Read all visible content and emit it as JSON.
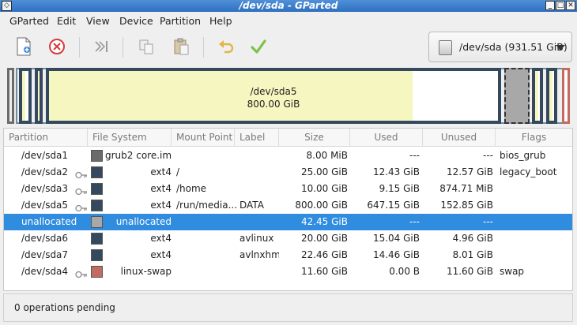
{
  "window": {
    "title": "/dev/sda - GParted"
  },
  "menu": [
    "GParted",
    "Edit",
    "View",
    "Device",
    "Partition",
    "Help"
  ],
  "toolbar": {
    "buttons": [
      "new-icon",
      "delete-icon",
      "resize-move-icon",
      "copy-icon",
      "paste-icon",
      "undo-icon",
      "apply-icon"
    ],
    "device": "/dev/sda  (931.51 GiB)"
  },
  "diskmap": {
    "selected_label": "/dev/sda5",
    "selected_size": "800.00 GiB",
    "colors": {
      "ext4": "#34495e",
      "swap": "#c26b5f",
      "unallocated": "#a8a8a8",
      "used": "#f6f6c0",
      "logical": "#6e8ba3"
    }
  },
  "table": {
    "columns": [
      "Partition",
      "File System",
      "Mount Point",
      "Label",
      "Size",
      "Used",
      "Unused",
      "Flags"
    ],
    "rows": [
      {
        "partition": "/dev/sda1",
        "fs": "grub2 core.img",
        "mount": "",
        "label": "",
        "size": "8.00 MiB",
        "used": "---",
        "unused": "---",
        "flags": "bios_grub",
        "color": "#6b6b6b",
        "key": false
      },
      {
        "partition": "/dev/sda2",
        "fs": "ext4",
        "mount": "/",
        "label": "",
        "size": "25.00 GiB",
        "used": "12.43 GiB",
        "unused": "12.57 GiB",
        "flags": "legacy_boot",
        "color": "#34495e",
        "key": true
      },
      {
        "partition": "/dev/sda3",
        "fs": "ext4",
        "mount": "/home",
        "label": "",
        "size": "10.00 GiB",
        "used": "9.15 GiB",
        "unused": "874.71 MiB",
        "flags": "",
        "color": "#34495e",
        "key": true
      },
      {
        "partition": "/dev/sda5",
        "fs": "ext4",
        "mount": "/run/media...",
        "label": "DATA",
        "size": "800.00 GiB",
        "used": "647.15 GiB",
        "unused": "152.85 GiB",
        "flags": "",
        "color": "#34495e",
        "key": true
      },
      {
        "partition": "unallocated",
        "fs": "unallocated",
        "mount": "",
        "label": "",
        "size": "42.45 GiB",
        "used": "---",
        "unused": "---",
        "flags": "",
        "color": "#a8a8a8",
        "key": false,
        "selected": true
      },
      {
        "partition": "/dev/sda6",
        "fs": "ext4",
        "mount": "",
        "label": "avlinux",
        "size": "20.00 GiB",
        "used": "15.04 GiB",
        "unused": "4.96 GiB",
        "flags": "",
        "color": "#34495e",
        "key": false
      },
      {
        "partition": "/dev/sda7",
        "fs": "ext4",
        "mount": "",
        "label": "avlnxhm",
        "size": "22.46 GiB",
        "used": "14.46 GiB",
        "unused": "8.01 GiB",
        "flags": "",
        "color": "#34495e",
        "key": false
      },
      {
        "partition": "/dev/sda4",
        "fs": "linux-swap",
        "mount": "",
        "label": "",
        "size": "11.60 GiB",
        "used": "0.00 B",
        "unused": "11.60 GiB",
        "flags": "swap",
        "color": "#c26b5f",
        "key": true
      }
    ]
  },
  "status": {
    "text": "0 operations pending"
  }
}
